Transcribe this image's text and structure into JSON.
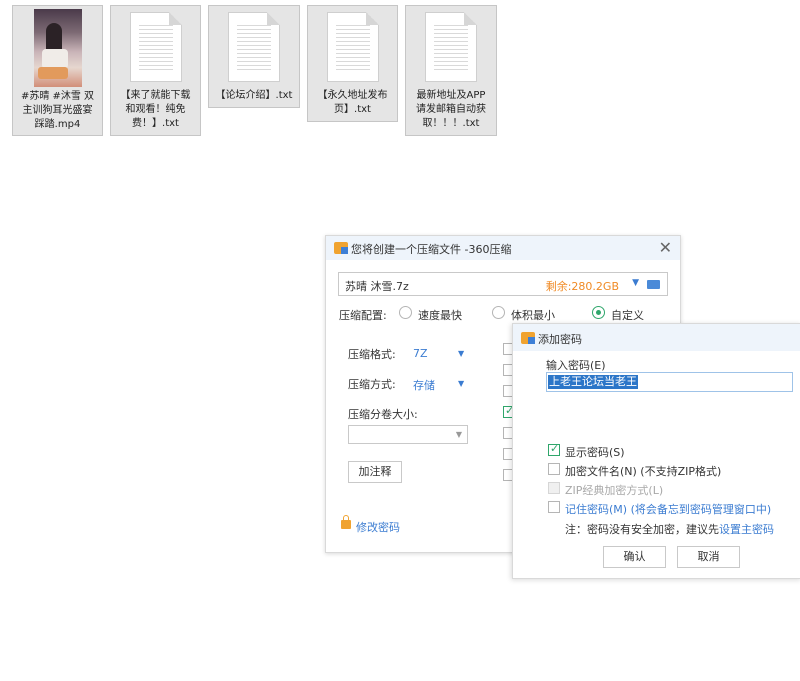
{
  "desktop": {
    "files": [
      {
        "name": "#苏晴 #沐雪 双主训狗耳光盛宴踩踏.mp4",
        "lines": [
          "#苏晴 #沐雪 双",
          "主训狗耳光盛宴",
          "踩踏.mp4"
        ],
        "kind": "video"
      },
      {
        "name": "【来了就能下载和观看！纯免费！】.txt",
        "lines": [
          "【来了就能下载",
          "和观看！纯免",
          "费！】.txt"
        ],
        "kind": "text"
      },
      {
        "name": "【论坛介绍】.txt",
        "lines": [
          "【论坛介绍】.txt"
        ],
        "kind": "text"
      },
      {
        "name": "【永久地址发布页】.txt",
        "lines": [
          "【永久地址发布",
          "页】.txt"
        ],
        "kind": "text"
      },
      {
        "name": "最新地址及APP请发邮箱自动获取！！！.txt",
        "lines": [
          "最新地址及APP",
          "请发邮箱自动获",
          "取！！！.txt"
        ],
        "kind": "text"
      }
    ]
  },
  "compress_dialog": {
    "title": "您将创建一个压缩文件 -360压缩",
    "filename": "苏晴 沐雪.7z",
    "free_space": "剩余:280.2GB",
    "config_label": "压缩配置:",
    "options": {
      "fastest": "速度最快",
      "smallest": "体积最小",
      "custom": "自定义"
    },
    "selected_option": "custom",
    "format_label": "压缩格式:",
    "format_value": "7Z",
    "method_label": "压缩方式:",
    "method_value": "存储",
    "volume_label": "压缩分卷大小:",
    "volume_value": "",
    "comment_button": "加注释",
    "change_password_link": "修改密码"
  },
  "password_dialog": {
    "title": "添加密码",
    "input_label": "输入密码(E)",
    "password_value": "上老王论坛当老王",
    "show_password": {
      "label": "显示密码(S)",
      "checked": true
    },
    "encrypt_filenames": {
      "label": "加密文件名(N) (不支持ZIP格式)",
      "checked": false
    },
    "zip_classic": {
      "label": "ZIP经典加密方式(L)",
      "checked": false,
      "disabled": true
    },
    "remember_password": {
      "label": "记住密码(M) (将会备忘到密码管理窗口中)",
      "checked": false
    },
    "note_prefix": "注：密码没有安全加密，建议先",
    "note_link": "设置主密码",
    "ok_button": "确认",
    "cancel_button": "取消"
  },
  "colors": {
    "accent_green": "#2fa66b",
    "link_blue": "#3b7cd1",
    "free_space_orange": "#f08a24",
    "selection_blue": "#2c76c8"
  }
}
